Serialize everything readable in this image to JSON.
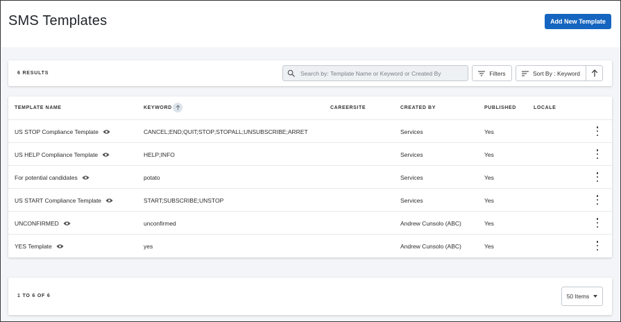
{
  "header": {
    "title": "SMS Templates",
    "add_button_label": "Add New Template"
  },
  "toolbar": {
    "results_count": "6 RESULTS",
    "search": {
      "placeholder": "Search by: Template Name or Keyword or Created By",
      "value": ""
    },
    "filters_label": "Filters",
    "sort_label": "Sort By : Keyword",
    "sort_direction_icon": "arrow-up-icon"
  },
  "table": {
    "columns": {
      "template_name": "TEMPLATE NAME",
      "keyword": "KEYWORD",
      "careersite": "CAREERSITE",
      "created_by": "CREATED BY",
      "published": "PUBLISHED",
      "locale": "LOCALE"
    },
    "rows": [
      {
        "name": "US STOP Compliance Template",
        "keyword": "CANCEL;END;QUIT;STOP;STOPALL;UNSUBSCRIBE;ARRET",
        "careersite": "",
        "created_by": "Services",
        "published": "Yes",
        "locale": ""
      },
      {
        "name": "US HELP Compliance Template",
        "keyword": "HELP;INFO",
        "careersite": "",
        "created_by": "Services",
        "published": "Yes",
        "locale": ""
      },
      {
        "name": "For potential candidates",
        "keyword": "potato",
        "careersite": "",
        "created_by": "Services",
        "published": "Yes",
        "locale": ""
      },
      {
        "name": "US START Compliance Template",
        "keyword": "START;SUBSCRIBE;UNSTOP",
        "careersite": "",
        "created_by": "Services",
        "published": "Yes",
        "locale": ""
      },
      {
        "name": "UNCONFIRMED",
        "keyword": "unconfirmed",
        "careersite": "",
        "created_by": "Andrew Cunsolo (ABC)",
        "published": "Yes",
        "locale": ""
      },
      {
        "name": "YES Template",
        "keyword": "yes",
        "careersite": "",
        "created_by": "Andrew Cunsolo (ABC)",
        "published": "Yes",
        "locale": ""
      }
    ]
  },
  "footer": {
    "paging_text": "1 TO 6 OF 6",
    "items_per_page": "50 Items"
  },
  "colors": {
    "primary": "#1565c0",
    "background": "#f3f5f8"
  }
}
